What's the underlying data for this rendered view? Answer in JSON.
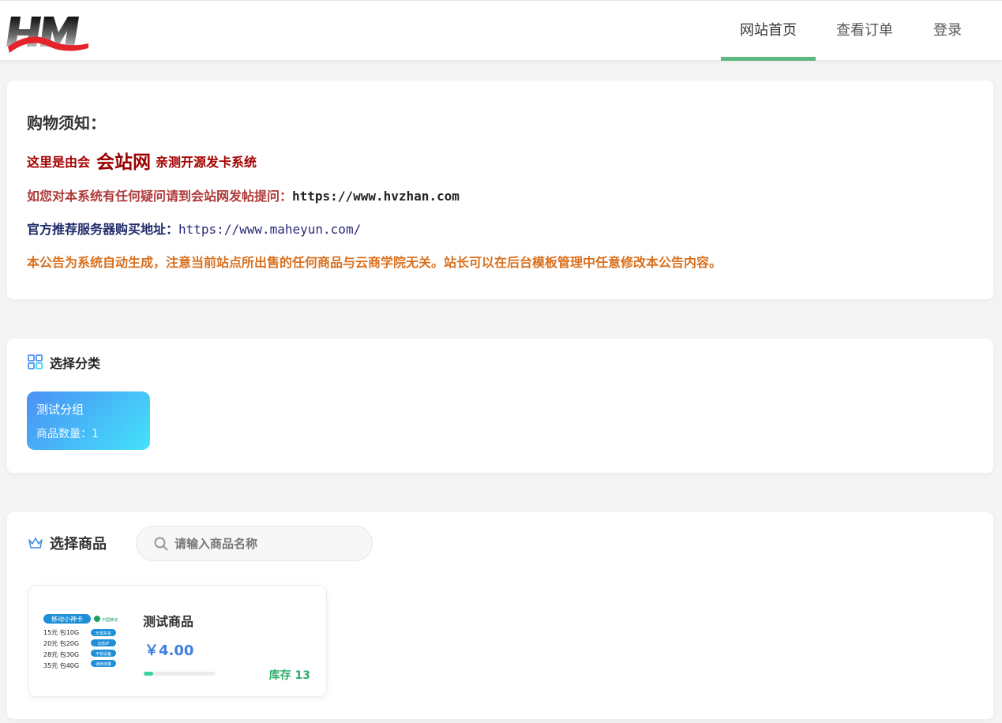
{
  "header": {
    "logo_text": "HM",
    "nav": [
      {
        "label": "网站首页",
        "active": true
      },
      {
        "label": "查看订单",
        "active": false
      },
      {
        "label": "登录",
        "active": false
      }
    ],
    "accent_color": "#5cb87f"
  },
  "notice": {
    "title": "购物须知：",
    "line1_prefix": "这里是由会",
    "line1_brand": "会站网",
    "line1_suffix": "亲测开源发卡系统",
    "line2_text": "如您对本系统有任何疑问请到会站网发帖提问：",
    "line2_url": "https://www.hvzhan.com",
    "line3_text": "官方推荐服务器购买地址：",
    "line3_url": "https://www.maheyun.com/",
    "line4_text": "本公告为系统自动生成，注意当前站点所出售的任何商品与云商学院无关。站长可以在后台模板管理中任意修改本公告内容。"
  },
  "category_section": {
    "title": "选择分类",
    "icon": "category-grid-icon",
    "categories": [
      {
        "name": "测试分组",
        "count_label": "商品数量：1"
      }
    ]
  },
  "goods_section": {
    "title": "选择商品",
    "icon": "crown-icon",
    "search_placeholder": "请输入商品名称",
    "products": [
      {
        "name": "测试商品",
        "price": "￥4.00",
        "stock_label": "库存 13",
        "stock_fraction": 0.13,
        "thumb": {
          "badge": "移动小神卡",
          "carrier": "中国移动",
          "plans": [
            "15元 包10G",
            "20元 包20G",
            "28元 包30G",
            "35元 包40G"
          ],
          "tags": [
            "无需实名",
            "动态IP",
            "不锁设备",
            "通用流量"
          ]
        }
      }
    ]
  }
}
